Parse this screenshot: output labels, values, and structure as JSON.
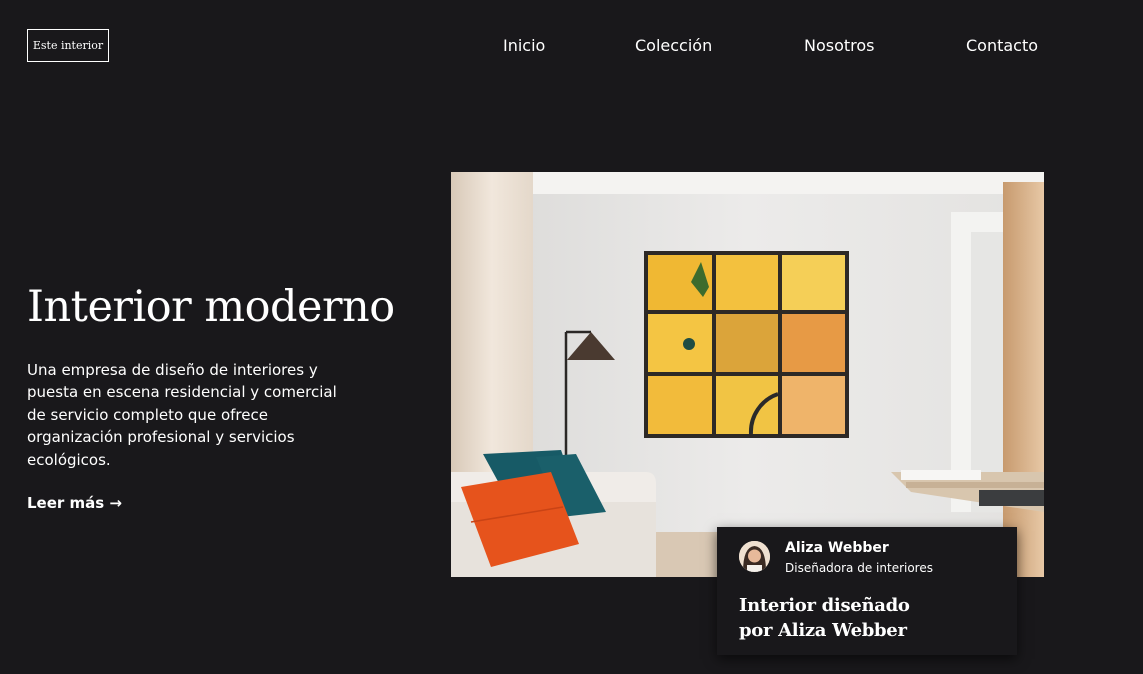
{
  "brand": {
    "logo_text": "Este interior"
  },
  "nav": {
    "items": [
      "Inicio",
      "Colección",
      "Nosotros",
      "Contacto"
    ]
  },
  "hero": {
    "title": "Interior moderno",
    "description": "Una empresa de diseño de interiores y puesta en escena residencial y comercial de servicio completo que ofrece organización profesional y servicios ecológicos.",
    "cta_label": "Leer más →",
    "image_icon": "living-room-photo"
  },
  "card": {
    "author_name": "Aliza Webber",
    "author_role": "Diseñadora de interiores",
    "title": "Interior diseñado por Aliza Webber",
    "avatar_icon": "avatar"
  },
  "colors": {
    "background": "#19181b",
    "text": "#ffffff",
    "cushion_orange": "#e6531c",
    "cushion_teal": "#175a66",
    "art_yellow": "#f0b833"
  }
}
